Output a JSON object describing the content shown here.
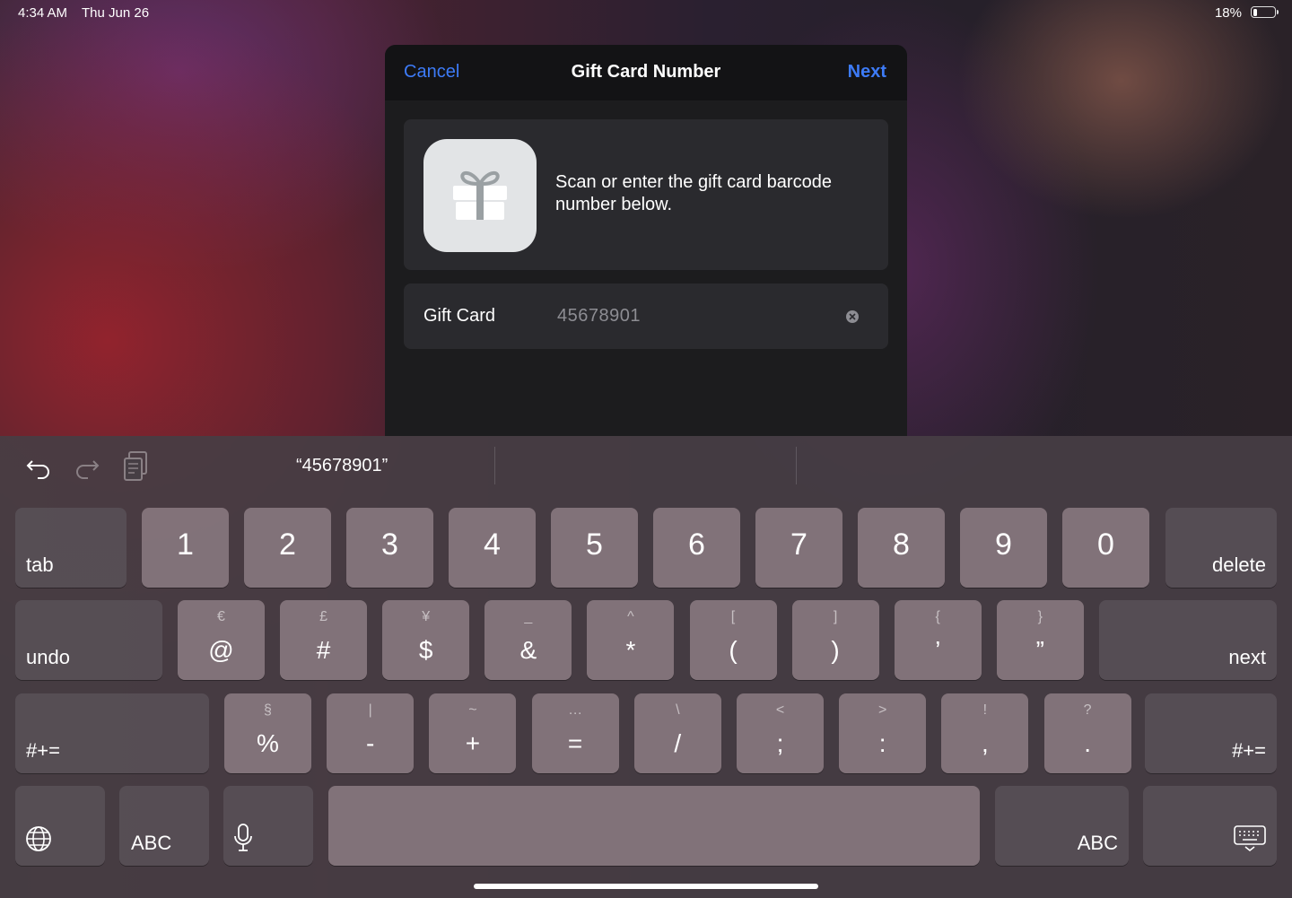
{
  "status": {
    "time": "4:34 AM",
    "date": "Thu Jun 26",
    "battery_pct": "18%",
    "battery_level": 0.18
  },
  "sheet": {
    "cancel_label": "Cancel",
    "title": "Gift Card Number",
    "next_label": "Next",
    "icon": "gift-icon",
    "description": "Scan or enter the gift card barcode number below.",
    "field_label": "Gift Card",
    "field_value": "45678901",
    "clear_icon": "clear-circle-icon"
  },
  "keyboard": {
    "toolbar": {
      "undo_icon": "undo-arrow-icon",
      "redo_icon": "redo-arrow-icon",
      "paste_icon": "clipboard-icon",
      "suggestion": "“45678901”"
    },
    "row1": {
      "tab": "tab",
      "keys": [
        "1",
        "2",
        "3",
        "4",
        "5",
        "6",
        "7",
        "8",
        "9",
        "0"
      ],
      "delete": "delete"
    },
    "row2": {
      "undo": "undo",
      "keys": [
        {
          "sub": "€",
          "main": "@"
        },
        {
          "sub": "£",
          "main": "#"
        },
        {
          "sub": "¥",
          "main": "$"
        },
        {
          "sub": "_",
          "main": "&"
        },
        {
          "sub": "^",
          "main": "*"
        },
        {
          "sub": "[",
          "main": "("
        },
        {
          "sub": "]",
          "main": ")"
        },
        {
          "sub": "{",
          "main": "’"
        },
        {
          "sub": "}",
          "main": "”"
        }
      ],
      "next": "next"
    },
    "row3": {
      "shift_left": "#+=",
      "keys": [
        {
          "sub": "§",
          "main": "%"
        },
        {
          "sub": "|",
          "main": "-"
        },
        {
          "sub": "~",
          "main": "+"
        },
        {
          "sub": "…",
          "main": "="
        },
        {
          "sub": "\\",
          "main": "/"
        },
        {
          "sub": "<",
          "main": ";"
        },
        {
          "sub": ">",
          "main": ":"
        },
        {
          "sub": "!",
          "main": ","
        },
        {
          "sub": "?",
          "main": "."
        }
      ],
      "shift_right": "#+="
    },
    "row4": {
      "globe_icon": "globe-icon",
      "abc_left": "ABC",
      "mic_icon": "microphone-icon",
      "abc_right": "ABC",
      "dismiss_icon": "keyboard-dismiss-icon"
    }
  }
}
